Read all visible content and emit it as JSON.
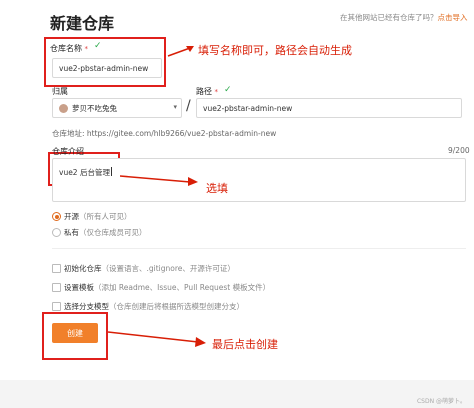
{
  "page": {
    "title": "新建仓库",
    "import_hint_prefix": "在其他网站已经有仓库了吗？",
    "import_link": "点击导入"
  },
  "form": {
    "repo_name": {
      "label": "仓库名称",
      "required_mark": "*",
      "value": "vue2-pbstar-admin-new"
    },
    "owner": {
      "label": "归属",
      "value": "萝贝不吃兔兔"
    },
    "path": {
      "label": "路径",
      "required_mark": "*",
      "separator": "/",
      "value": "vue2-pbstar-admin-new"
    },
    "repo_url": "仓库地址: https://gitee.com/hlb9266/vue2-pbstar-admin-new",
    "description": {
      "label": "仓库介绍",
      "value": "vue2 后台管理",
      "counter": "9/200"
    },
    "visibility": [
      {
        "label": "开源",
        "hint": "（所有人可见）",
        "selected": true
      },
      {
        "label": "私有",
        "hint": "（仅仓库成员可见）",
        "selected": false
      }
    ],
    "options": [
      {
        "label": "初始化仓库",
        "hint": "（设置语言、.gitignore、开源许可证）"
      },
      {
        "label": "设置模板",
        "hint": "（添加 Readme、Issue、Pull Request 模板文件）"
      },
      {
        "label": "选择分支模型",
        "hint": "（仓库创建后将根据所选模型创建分支）"
      }
    ],
    "create_button": "创建"
  },
  "annotations": {
    "name_hint": "填写名称即可，路径会自动生成",
    "description_hint": "选填",
    "create_hint": "最后点击创建"
  },
  "watermark": "CSDN @萌萝卜。",
  "icons": {
    "check": "check-icon",
    "dropdown": "chevron-down-icon",
    "avatar": "avatar-icon"
  },
  "colors": {
    "accent": "#f1802a",
    "annotation_red": "#e0201c",
    "check_green": "#2aa94a"
  }
}
